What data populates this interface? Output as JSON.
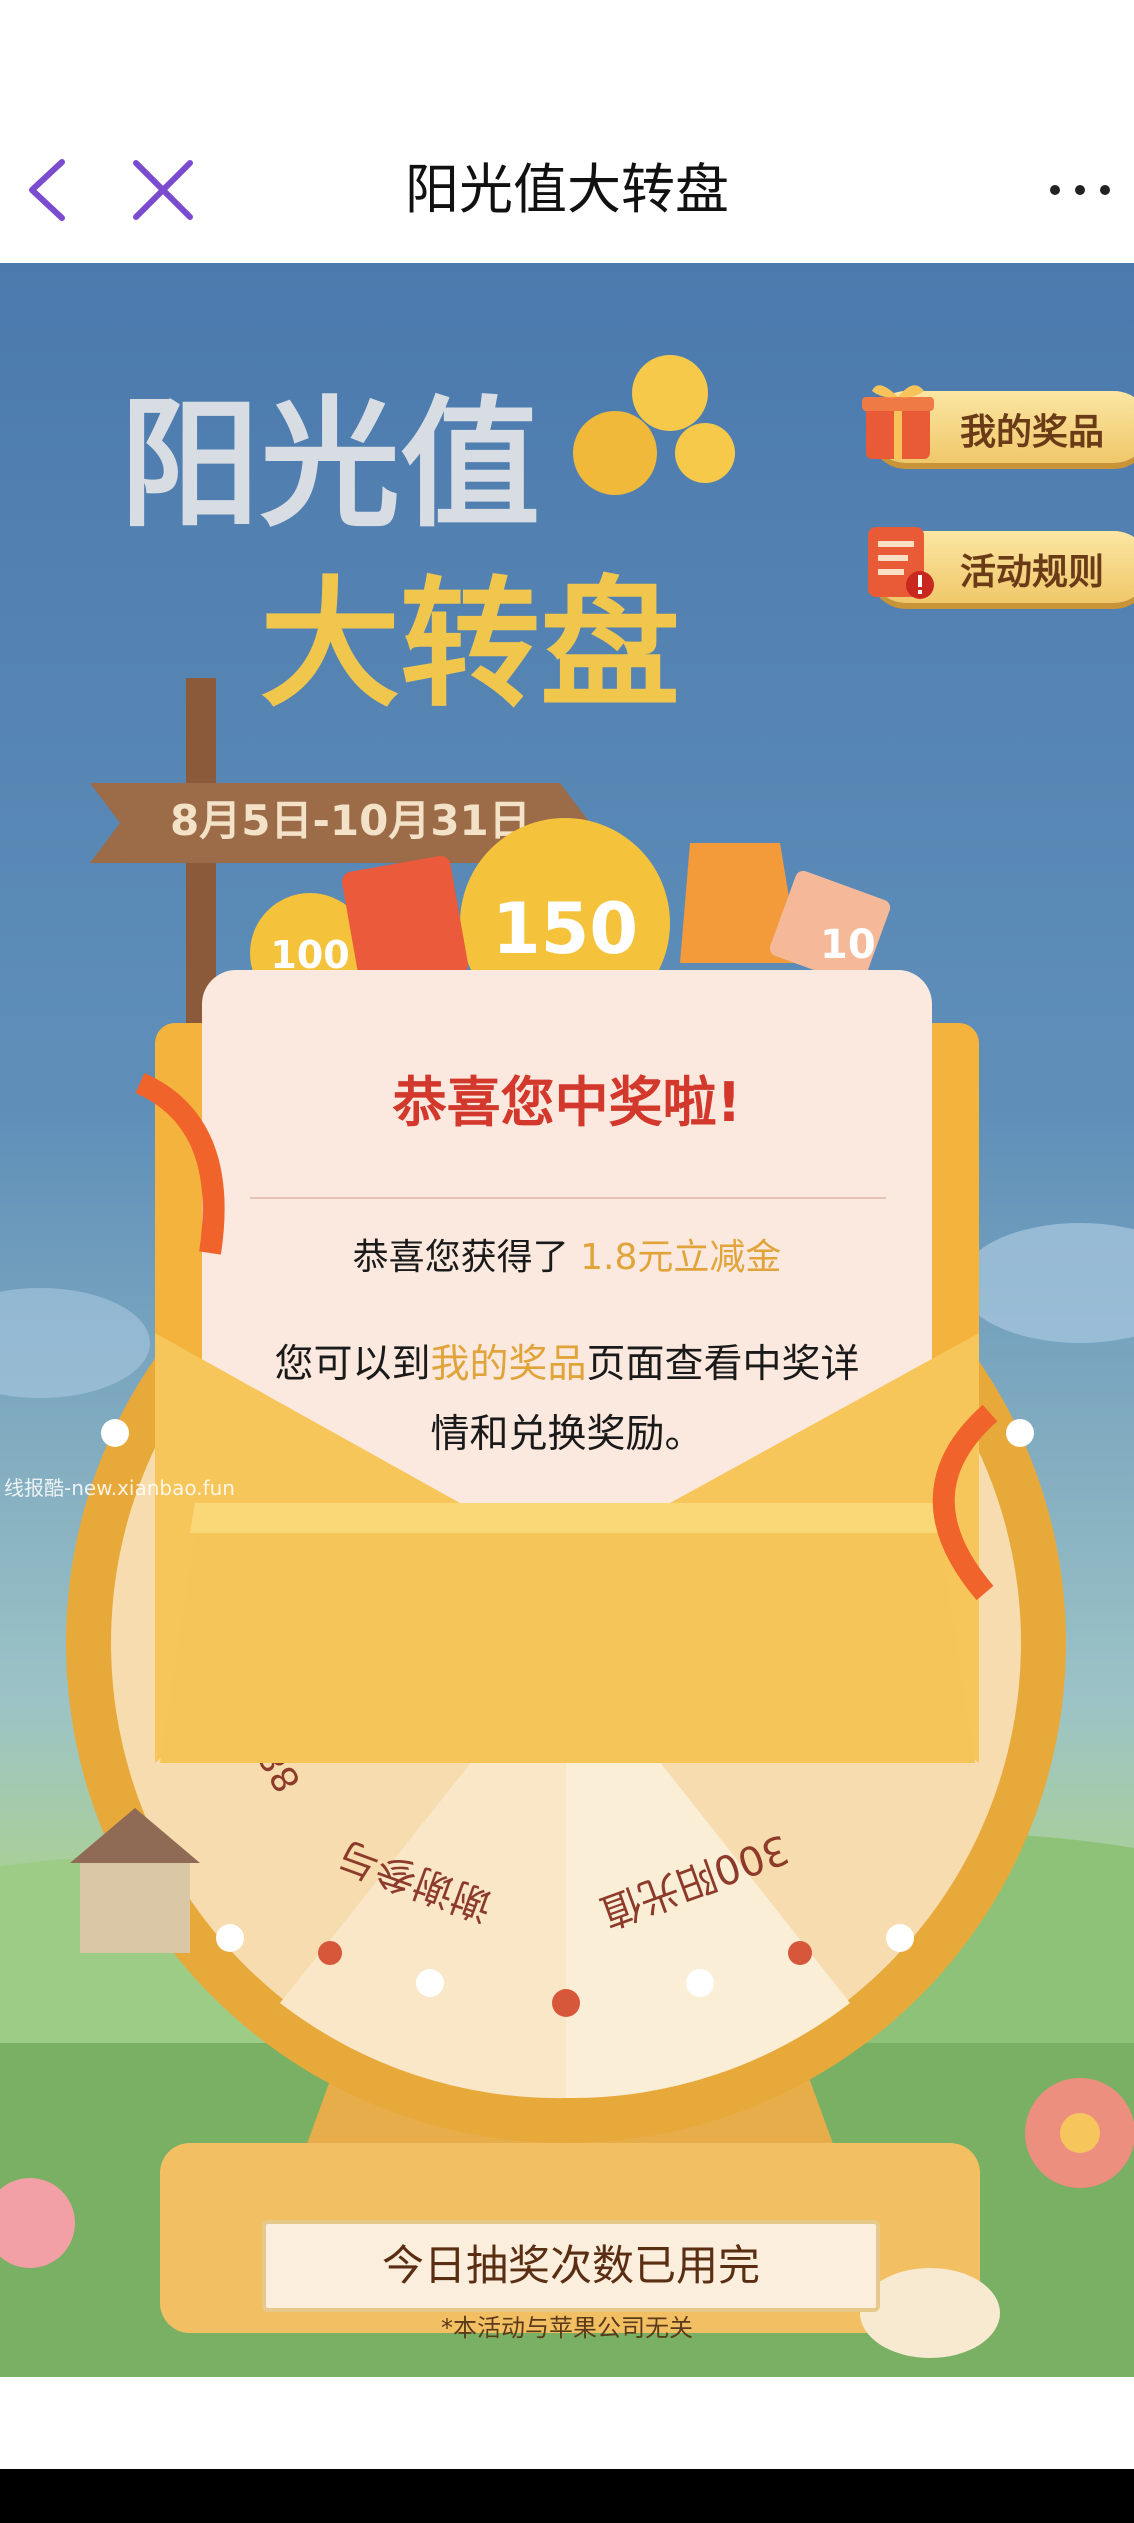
{
  "nav": {
    "title": "阳光值大转盘",
    "back_icon": "chevron-left-icon",
    "close_icon": "close-icon",
    "more_icon": "more-horizontal-icon",
    "accent": "#7b4bd0"
  },
  "banner": {
    "line1": "阳光值",
    "line2": "大转盘",
    "date": "8月5日-10月31日"
  },
  "side_buttons": [
    {
      "label": "我的奖品",
      "icon": "gift-box-icon"
    },
    {
      "label": "活动规则",
      "icon": "rules-clipboard-icon"
    }
  ],
  "coins": {
    "big": "150",
    "small": "100",
    "ticket": "10"
  },
  "wheel": {
    "segments": [
      "谢谢参与",
      "300阳光值",
      "88"
    ]
  },
  "popup": {
    "title": "恭喜您中奖啦!",
    "msg_prefix": "恭喜您获得了 ",
    "prize": "1.8元立减金",
    "msg2_a": "您可以到",
    "msg2_link": "我的奖品",
    "msg2_b": "页面查看中奖详",
    "msg2_c": "情和兑换奖励。"
  },
  "bottom": {
    "button": "今日抽奖次数已用完",
    "disclaimer": "*本活动与苹果公司无关"
  },
  "watermark": "线报酷-new.xianbao.fun",
  "colors": {
    "header_bg": "#ffffff",
    "sky": "#4b79ad",
    "popup_title": "#d3382c",
    "prize_gold": "#e0a43a"
  }
}
